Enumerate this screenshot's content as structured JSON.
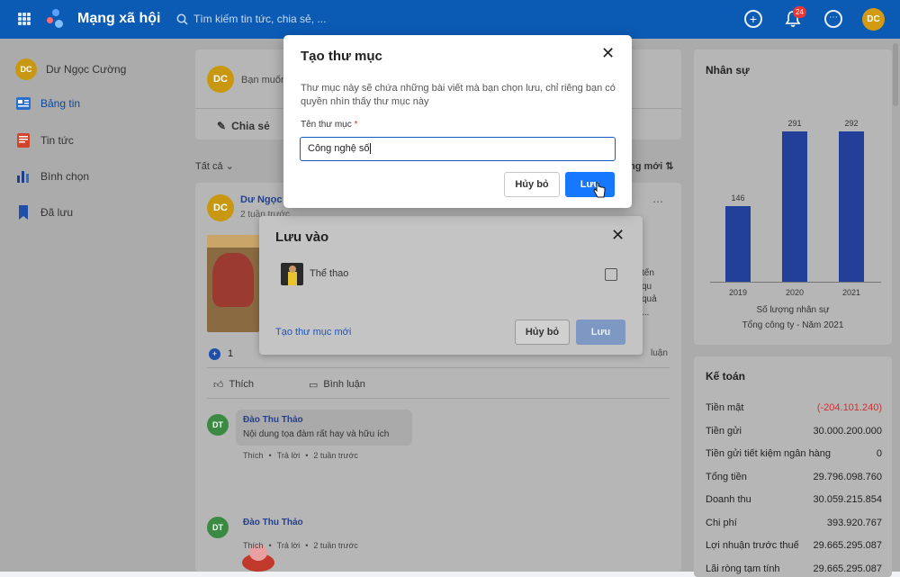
{
  "topbar": {
    "app_title": "Mạng xã hội",
    "search_placeholder": "Tìm kiếm tin tức, chia sẻ, ...",
    "notification_count": "24",
    "user_initials": "DC"
  },
  "sidebar": {
    "user_name": "Dư Ngọc Cường",
    "user_initials": "DC",
    "items": [
      {
        "label": "Bảng tin"
      },
      {
        "label": "Tin tức"
      },
      {
        "label": "Bình chọn"
      },
      {
        "label": "Đã lưu"
      }
    ]
  },
  "composer": {
    "initials": "DC",
    "placeholder": "Bạn muốn",
    "share_label": "Chia sẻ"
  },
  "filter": {
    "left_label": "Tất cả",
    "right_label": "ng mới"
  },
  "post": {
    "author": "Dư Ngọc",
    "initials": "DC",
    "time": "2 tuần trước",
    "text_snips": [
      "tến",
      "qu",
      "quả",
      "..."
    ],
    "reaction_count": "1",
    "comments_count_snip": "luận",
    "like_label": "Thích",
    "comment_label": "Bình luận",
    "comments": [
      {
        "initials": "DT",
        "author": "Đào Thu Thảo",
        "text": "Nội dung tọa đàm rất hay và hữu ích",
        "like": "Thích",
        "reply": "Trả lời",
        "time": "2 tuần trước"
      },
      {
        "initials": "DT",
        "author": "Đào Thu Thảo",
        "text": "",
        "like": "Thích",
        "reply": "Trả lời",
        "time": "2 tuần trước"
      }
    ]
  },
  "staff_panel": {
    "title": "Nhân sự",
    "caption1": "Số lượng nhân sự",
    "caption2": "Tổng công ty - Năm 2021"
  },
  "chart_data": {
    "type": "bar",
    "categories": [
      "2019",
      "2020",
      "2021"
    ],
    "values": [
      146,
      291,
      292
    ],
    "title": "",
    "xlabel": "Số lượng nhân sự",
    "ylabel": "",
    "ylim": [
      0,
      300
    ],
    "colors": {
      "bar": "#22409a"
    }
  },
  "accounting_panel": {
    "title": "Kế toán",
    "rows": [
      {
        "label": "Tiền mặt",
        "value": "(-204.101.240)",
        "negative": true
      },
      {
        "label": "Tiền gửi",
        "value": "30.000.200.000"
      },
      {
        "label": "Tiền gửi tiết kiệm ngân hàng",
        "value": "0"
      },
      {
        "label": "Tổng tiền",
        "value": "29.796.098.760"
      },
      {
        "label": "Doanh thu",
        "value": "30.059.215.854"
      },
      {
        "label": "Chi phí",
        "value": "393.920.767"
      },
      {
        "label": "Lợi nhuận trước thuế",
        "value": "29.665.295.087"
      },
      {
        "label": "Lãi ròng tạm tính",
        "value": "29.665.295.087"
      }
    ]
  },
  "save_to_dialog": {
    "title": "Lưu vào",
    "folder_name": "Thể thao",
    "new_folder_link": "Tạo thư mục mới",
    "cancel_label": "Hủy bỏ",
    "save_label": "Lưu"
  },
  "create_folder_dialog": {
    "title": "Tạo thư mục",
    "description": "Thư mục này sẽ chứa những bài viết mà bạn chọn lưu, chỉ riêng bạn có quyền nhìn thấy thư mục này",
    "field_label": "Tên thư mục",
    "required_mark": "*",
    "field_value": "Công nghệ số",
    "cancel_label": "Hủy bỏ",
    "save_label": "Lưu"
  },
  "colors": {
    "topbar": "#0b5bb5",
    "primary": "#1677ff",
    "link": "#1a56c4",
    "negative": "#d32f2f"
  }
}
